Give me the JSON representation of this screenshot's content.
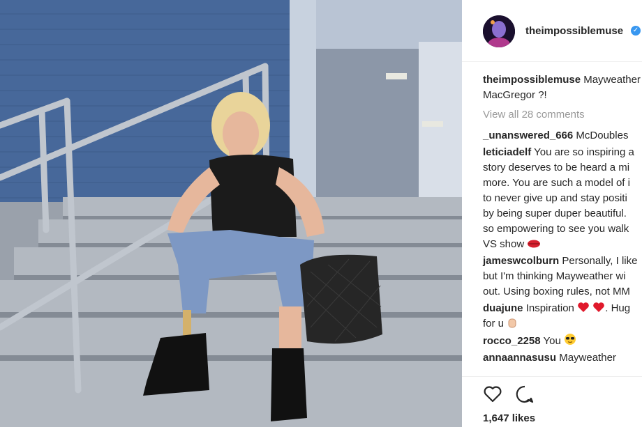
{
  "post": {
    "username": "theimpossiblemuse",
    "verified": true,
    "caption_user": "theimpossiblemuse",
    "caption_line1": "Mayweather",
    "caption_line2": "MacGregor ?!",
    "view_all": "View all 28 comments",
    "comments": [
      {
        "user": "_unanswered_666",
        "lines": [
          "McDoubles"
        ]
      },
      {
        "user": "leticiadelf",
        "lines": [
          "You are so inspiring a",
          "story deserves to be heard a mi",
          "more. You are such a model of i",
          "to never give up and stay positi",
          "by being super duper beautiful.",
          "so empowering to see you walk",
          "VS show"
        ]
      },
      {
        "user": "jameswcolburn",
        "lines": [
          "Personally, I like",
          "but I'm thinking Mayweather wi",
          "out. Using boxing rules, not MM"
        ]
      },
      {
        "user": "duajune",
        "lines": [
          "Inspiration",
          ". Hug",
          "for u"
        ]
      },
      {
        "user": "rocco_2258",
        "lines": [
          "You"
        ]
      },
      {
        "user": "annaannasusu",
        "lines": [
          "Mayweather"
        ]
      }
    ],
    "likes": "1,647 likes"
  },
  "icons": {
    "verified": "verified-badge-icon",
    "like": "heart-icon",
    "comment": "comment-bubble-icon"
  },
  "colors": {
    "verified": "#3897f0",
    "muted": "#999999",
    "text": "#262626",
    "brick": "#4a6ea0"
  }
}
